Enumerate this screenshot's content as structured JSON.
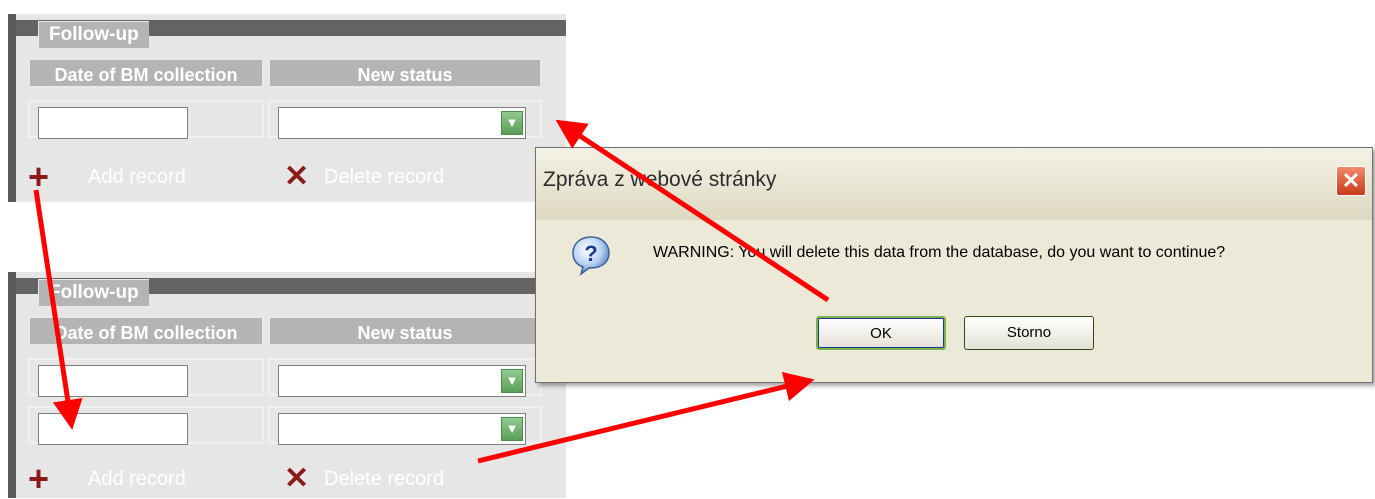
{
  "panels": [
    {
      "legend": "Follow-up",
      "col1_header": "Date of BM collection",
      "col2_header": "New status",
      "add_label": "Add record",
      "delete_label": "Delete record"
    },
    {
      "legend": "Follow-up",
      "col1_header": "Date of BM collection",
      "col2_header": "New status",
      "add_label": "Add record",
      "delete_label": "Delete record"
    }
  ],
  "dialog": {
    "title": "Zpráva z webové stránky",
    "message": "WARNING: You will delete this data from the database, do you want to continue?",
    "ok_label": "OK",
    "cancel_label": "Storno",
    "close_glyph": "✕"
  },
  "icons": {
    "add": "+",
    "delete": "✕",
    "dropdown": "▼"
  },
  "colors": {
    "arrow": "#ff0000",
    "panel_bg": "#e6e6e6",
    "header_bg": "#b4b4b4",
    "icon_red": "#8b1a1a"
  }
}
